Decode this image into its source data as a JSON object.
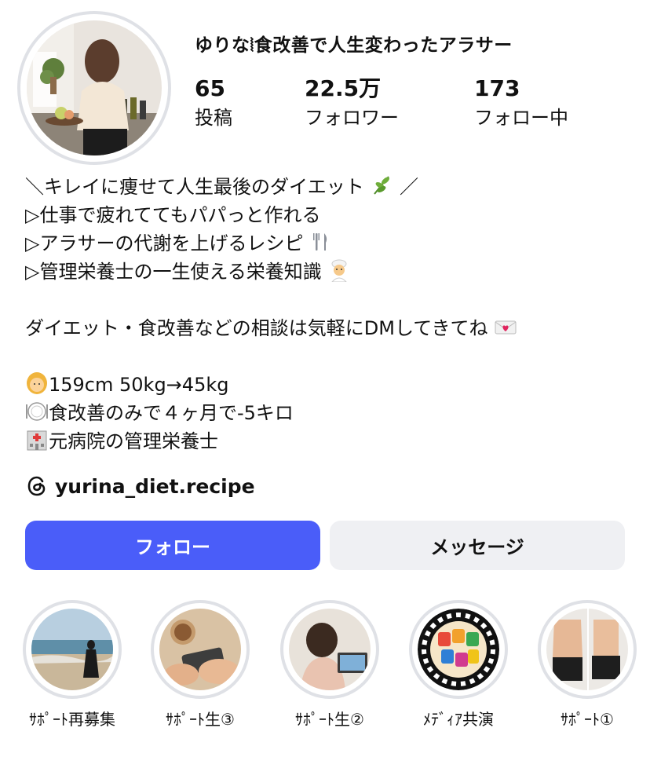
{
  "profile": {
    "name": "ゆりな⦚食改善で人生変わったアラサー",
    "stats": [
      {
        "value": "65",
        "label": "投稿"
      },
      {
        "value": "22.5万",
        "label": "フォロワー"
      },
      {
        "value": "173",
        "label": "フォロー中"
      }
    ]
  },
  "bio": {
    "line1": "＼キレイに痩せて人生最後のダイエット",
    "line1_end": "／",
    "line2": "▷仕事で疲れててもパパっと作れる",
    "line3": "▷アラサーの代謝を上げるレシピ",
    "line4": "▷管理栄養士の一生使える栄養知識",
    "line5": "ダイエット・食改善などの相談は気軽にDMしてきてね",
    "line6": "159cm 50kg→45kg",
    "line7": "食改善のみで４ヶ月で-5キロ",
    "line8": "元病院の管理栄養士"
  },
  "threads": {
    "handle": "yurina_diet.recipe"
  },
  "actions": {
    "follow": "フォロー",
    "message": "メッセージ"
  },
  "highlights": [
    {
      "label": "ｻﾎﾟｰﾄ再募集"
    },
    {
      "label": "ｻﾎﾟｰﾄ生③"
    },
    {
      "label": "ｻﾎﾟｰﾄ生②"
    },
    {
      "label": "ﾒﾃﾞｨｱ共演"
    },
    {
      "label": "ｻﾎﾟｰﾄ①"
    }
  ],
  "colors": {
    "follow_button": "#4a5df9",
    "message_button": "#eff0f3",
    "ring": "#dfe1e6"
  }
}
